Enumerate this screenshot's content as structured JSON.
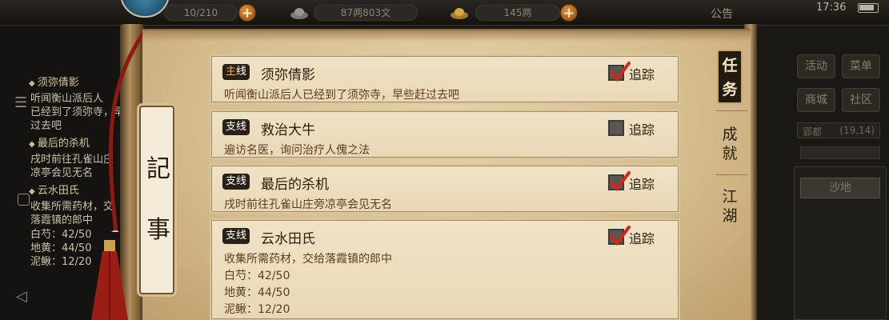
{
  "topbar": {
    "stamina": "10/210",
    "copper": "87两803文",
    "silver": "145两",
    "announce": "公告",
    "time": "17:36"
  },
  "left_side": {
    "entries": [
      {
        "title": "须弥倩影",
        "lines": [
          "听闻衡山派后人",
          "已经到了须弥寺，早",
          "过去吧"
        ]
      },
      {
        "title": "最后的杀机",
        "lines": [
          "戌时前往孔雀山庄",
          "凉亭会见无名"
        ]
      },
      {
        "title": "云水田氏",
        "lines": [
          "收集所需药材，交",
          "落霞镇的郎中",
          "白芍：42/50",
          "地黄：44/50",
          "泥鳅：12/20"
        ]
      }
    ]
  },
  "right_side": {
    "buttons": [
      "活动",
      "菜单",
      "商城",
      "社区"
    ],
    "info": "(19,14)",
    "info_label": "郢都",
    "land_button": "沙地"
  },
  "scroll": {
    "title_chars": [
      "記",
      "事"
    ]
  },
  "quests": [
    {
      "badge_first": "主",
      "badge_second": "线",
      "title": "须弥倩影",
      "desc": [
        "听闻衡山派后人已经到了须弥寺，早些赶过去吧"
      ],
      "tracked": true,
      "track_label": "追踪"
    },
    {
      "badge_first": "支",
      "badge_second": "线",
      "title": "救治大牛",
      "desc": [
        "遍访名医，询问治疗人傀之法"
      ],
      "tracked": false,
      "track_label": "追踪"
    },
    {
      "badge_first": "支",
      "badge_second": "线",
      "title": "最后的杀机",
      "desc": [
        "戌时前往孔雀山庄旁凉亭会见无名"
      ],
      "tracked": true,
      "track_label": "追踪"
    },
    {
      "badge_first": "支",
      "badge_second": "线",
      "title": "云水田氏",
      "desc": [
        "收集所需药材，交给落霞镇的郎中",
        "白芍：42/50",
        "地黄：44/50",
        "泥鳅：12/20"
      ],
      "tracked": true,
      "track_label": "追踪"
    }
  ],
  "tabs": {
    "active": [
      "任",
      "务"
    ],
    "achievement": [
      "成",
      "就"
    ],
    "world": [
      "江",
      "湖"
    ]
  },
  "colors": {
    "paper": "#e6d2a9",
    "main_badge": "#f0b23a",
    "check_red": "#d0281a",
    "tab_active_bg": "#231b12"
  }
}
